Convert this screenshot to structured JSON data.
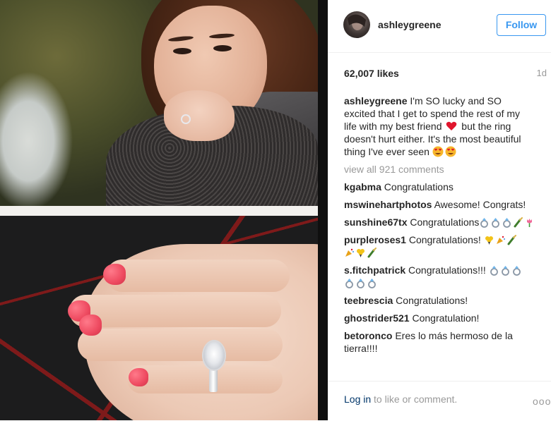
{
  "post": {
    "username": "ashleygreene",
    "follow_label": "Follow",
    "likes": "62,007 likes",
    "age": "1d",
    "caption_parts": {
      "username": "ashleygreene",
      "part1": " I'm SO lucky and SO excited that I get to spend the rest of my life with my best friend ",
      "part2": " but the ring doesn't hurt either. It's the most beautiful thing I've ever seen "
    },
    "view_all": "view all 921 comments"
  },
  "comments": [
    {
      "user": "kgabma",
      "text": " Congratulations"
    },
    {
      "user": "mswinehartphotos",
      "text": " Awesome! Congrats!"
    },
    {
      "user": "sunshine67tx",
      "text": " Congratulations"
    },
    {
      "user": "purpleroses1",
      "text": " Congratulations! "
    },
    {
      "user": "s.fitchpatrick",
      "text": " Congratulations!!! "
    },
    {
      "user": "teebrescia",
      "text": " Congratulations!"
    },
    {
      "user": "ghostrider521",
      "text": " Congratulation!"
    },
    {
      "user": "betoronco",
      "text": " Eres lo más hermoso de la tierra!!!!"
    }
  ],
  "footer": {
    "login_link": "Log in",
    "login_rest": " to like or comment.",
    "more": "ooo"
  },
  "colors": {
    "link_blue": "#3897f0",
    "text_dark": "#262626",
    "muted": "#999999",
    "nail_pink": "#ee4a60"
  },
  "icons": [
    "red-heart-emoji",
    "heart-eyes-emoji",
    "ring-emoji",
    "champagne-emoji",
    "tulip-emoji",
    "bouquet-emoji",
    "party-popper-emoji",
    "more-options-icon"
  ]
}
